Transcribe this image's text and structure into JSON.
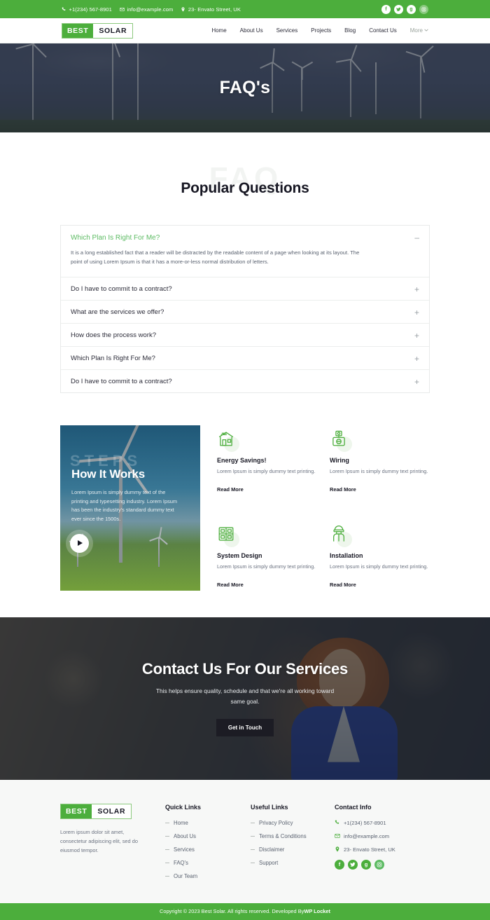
{
  "topbar": {
    "phone": "+1(234) 567-8901",
    "email": "info@example.com",
    "address": "23- Envato Street, UK",
    "socials": [
      {
        "name": "facebook-icon",
        "glyph": "f"
      },
      {
        "name": "twitter-icon",
        "glyph": "t"
      },
      {
        "name": "google-plus-icon",
        "glyph": "g"
      },
      {
        "name": "instagram-icon",
        "glyph": "◎"
      }
    ],
    "bg_color": "#4CAE3C"
  },
  "header": {
    "logo_first": "BEST",
    "logo_second": "SOLAR",
    "menu": [
      {
        "label": "Home"
      },
      {
        "label": "About Us"
      },
      {
        "label": "Services"
      },
      {
        "label": "Projects"
      },
      {
        "label": "Blog"
      },
      {
        "label": "Contact Us"
      }
    ],
    "more_label": "More",
    "more_caret": "⌄"
  },
  "hero": {
    "title": "FAQ's"
  },
  "faq": {
    "watermark": "FAQ",
    "title": "Popular Questions",
    "items": [
      {
        "question": "Which Plan Is Right For Me?",
        "sign": "–",
        "open": true,
        "answer": "It is a long established fact that a reader will be distracted by the readable content of a page when looking at its layout. The point of using Lorem Ipsum is that it has a more-or-less normal distribution of letters."
      },
      {
        "question": "Do I have to commit to a contract?",
        "sign": "+",
        "open": false,
        "answer": ""
      },
      {
        "question": "What are the services we offer?",
        "sign": "+",
        "open": false,
        "answer": ""
      },
      {
        "question": "How does the process work?",
        "sign": "+",
        "open": false,
        "answer": ""
      },
      {
        "question": "Which Plan Is Right For Me?",
        "sign": "+",
        "open": false,
        "answer": ""
      },
      {
        "question": "Do I have to commit to a contract?",
        "sign": "+",
        "open": false,
        "answer": ""
      }
    ]
  },
  "works": {
    "watermark": "STEPS",
    "title": "How It Works",
    "text": "Lorem Ipsum is simply dummy text of the printing and typesetting industry. Lorem Ipsum has been the industry's standard dummy text ever since the 1500s.",
    "features": [
      {
        "icon": "solar-house-icon",
        "title": "Energy Savings!",
        "text": "Lorem Ipsum is simply dummy text printing.",
        "link": "Read More"
      },
      {
        "icon": "wiring-meter-icon",
        "title": "Wiring",
        "text": "Lorem Ipsum is simply dummy text printing.",
        "link": "Read More"
      },
      {
        "icon": "solar-panel-icon",
        "title": "System Design",
        "text": "Lorem Ipsum is simply dummy text printing.",
        "link": "Read More"
      },
      {
        "icon": "worker-icon",
        "title": "Installation",
        "text": "Lorem Ipsum is simply dummy text printing.",
        "link": "Read More"
      }
    ]
  },
  "cta": {
    "title": "Contact Us For Our Services",
    "subtitle": "This helps ensure quality, schedule and that we're all working toward same goal.",
    "button": "Get in Touch"
  },
  "footer": {
    "logo_first": "BEST",
    "logo_second": "SOLAR",
    "description": "Lorem ipsum dolor sit amet, consectetur adipiscing elit, sed do eiusmod tempor.",
    "quick_links_title": "Quick Links",
    "quick_links": [
      {
        "label": "Home"
      },
      {
        "label": "About Us"
      },
      {
        "label": "Services"
      },
      {
        "label": "FAQ's"
      },
      {
        "label": "Our Team"
      }
    ],
    "useful_links_title": "Useful Links",
    "useful_links": [
      {
        "label": "Privacy Policy"
      },
      {
        "label": "Terms & Conditions"
      },
      {
        "label": "Disclaimer"
      },
      {
        "label": "Support"
      }
    ],
    "contact_title": "Contact Info",
    "phone": "+1(234) 567-8901",
    "email": "info@example.com",
    "address": "23- Envato Street, UK",
    "socials": [
      {
        "name": "facebook-icon",
        "glyph": "f"
      },
      {
        "name": "twitter-icon",
        "glyph": "t"
      },
      {
        "name": "google-plus-icon",
        "glyph": "g"
      },
      {
        "name": "instagram-icon",
        "glyph": "◎"
      }
    ]
  },
  "copyright": {
    "text": "Copyright © 2023 Best Solar. All rights reserved. Developed By ",
    "brand": "WP Locket"
  }
}
